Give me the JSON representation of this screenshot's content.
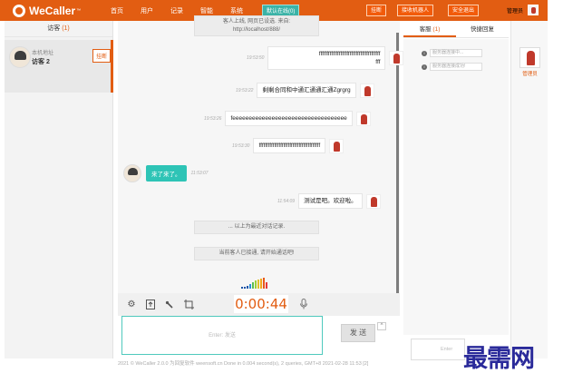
{
  "app": {
    "name": "WeCaller",
    "tm": "™"
  },
  "nav": {
    "items": [
      "首页",
      "用户",
      "记录",
      "智能",
      "系统"
    ],
    "online_btn": "默认在线(0)"
  },
  "topbar": {
    "btn_hangup": "挂断",
    "btn_robot": "接收机器人",
    "btn_logout": "安全退出",
    "admin_label": "管理员"
  },
  "left": {
    "title": "访客",
    "count": "(1)",
    "visitor_sub": "本机地址",
    "visitor_name": "访客 2",
    "hangup": "挂断"
  },
  "chat": {
    "top_note_1": "客人上线, 网页已设选. 来自:",
    "top_note_2": "http://localhost/888/",
    "messages": [
      {
        "time": "19:53:50",
        "text": "ffffffffffffffffffffffffffffffffffffffff",
        "line2": "fff"
      },
      {
        "time": "19:53:22",
        "text": "剩剩合同和中通汇通通汇通Zgrgrg"
      },
      {
        "time": "19:53:26",
        "text": "feeeeeeeeeeeeeeeeeeeeeeeeeeeeeeeeeee"
      },
      {
        "time": "19:53:30",
        "text": "ffffffffffffffffffffffffffffffffffffffff"
      },
      {
        "time": "11:53:07",
        "text": "来了来了。"
      },
      {
        "time": "11:54:09",
        "text": "测试是吧。欢迎啦。"
      }
    ],
    "history_note": "... 以上为最近对话记录.",
    "connected_note": "当前客人已接通, 请开始通话吧!"
  },
  "toolbar": {
    "timer": "0:00:44",
    "gear_icon": "gear-icon",
    "upload_icon": "upload-icon",
    "wrench_icon": "wrench-icon",
    "screenshot_icon": "screenshot-icon",
    "mic_icon": "microphone-icon"
  },
  "input": {
    "placeholder": "Enter: 发送",
    "send_label": "发 送",
    "arrow": "^"
  },
  "footer": {
    "text": "2021 © WeCaller 2.0.0 为回复软件 weensoft.cn Done in 0.004 second(s), 2 queries, GMT+8 2021-02-28 11:53 [2]"
  },
  "right": {
    "tab_service": "客服",
    "tab_service_count": "(1)",
    "tab_quick": "快捷回复",
    "status_1": "服务器连接中...",
    "status_2": "服务器连接成功!",
    "bottom_placeholder": "Enter"
  },
  "agent": {
    "name": "管理员"
  },
  "watermark": "最需网",
  "colors": {
    "brand": "#e25d12",
    "teal": "#2ec4b6"
  }
}
